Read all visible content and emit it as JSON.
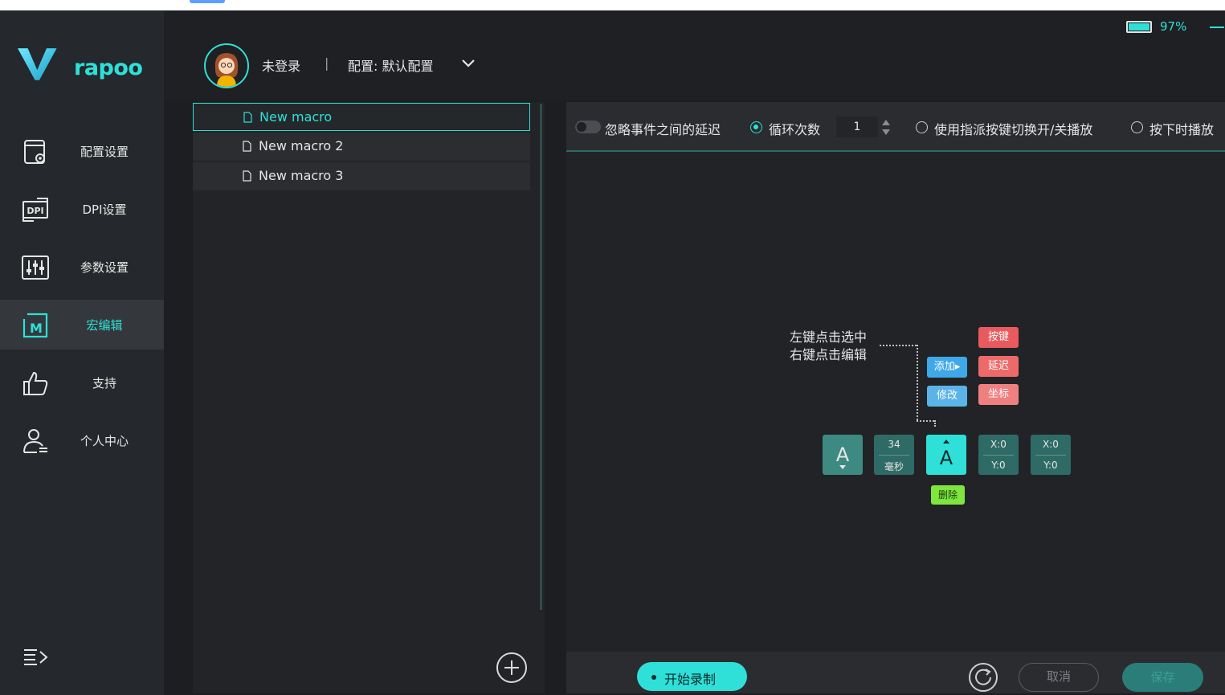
{
  "brand": {
    "logo_text": "rapoo",
    "accent": "#2fe0d8"
  },
  "header": {
    "login_status": "未登录",
    "separator": "|",
    "profile_label": "配置: 默认配置",
    "battery_pct": "97%"
  },
  "sidebar": {
    "items": [
      {
        "label": "配置设置",
        "icon": "config-icon"
      },
      {
        "label": "DPI设置",
        "icon": "dpi-icon"
      },
      {
        "label": "参数设置",
        "icon": "sliders-icon"
      },
      {
        "label": "宏编辑",
        "icon": "macro-icon",
        "active": true
      },
      {
        "label": "支持",
        "icon": "thumbs-up-icon"
      },
      {
        "label": "个人中心",
        "icon": "user-icon"
      }
    ],
    "dpi_icon_text": "DPI"
  },
  "macros": [
    {
      "name": "New macro",
      "selected": true
    },
    {
      "name": "New macro 2"
    },
    {
      "name": "New macro 3"
    }
  ],
  "options": {
    "ignore_delay": "忽略事件之间的延迟",
    "loop_count_label": "循环次数",
    "loop_count_value": "1",
    "toggle_key_label": "使用指派按键切换开/关播放",
    "hold_play_label": "按下时播放"
  },
  "guide": {
    "hint_line1": "左键点击选中",
    "hint_line2": "右键点击编辑",
    "add": "添加▸",
    "modify": "修改",
    "key": "按键",
    "delay": "延迟",
    "coord": "坐标",
    "delete": "删除",
    "events": [
      {
        "type": "key-down",
        "label": "A"
      },
      {
        "type": "delay",
        "value": "34",
        "unit": "毫秒"
      },
      {
        "type": "key-up",
        "label": "A"
      },
      {
        "type": "coord",
        "x": "X:0",
        "y": "Y:0"
      },
      {
        "type": "coord",
        "x": "X:0",
        "y": "Y:0"
      }
    ]
  },
  "footer": {
    "record": "开始录制",
    "cancel": "取消",
    "save": "保存"
  }
}
